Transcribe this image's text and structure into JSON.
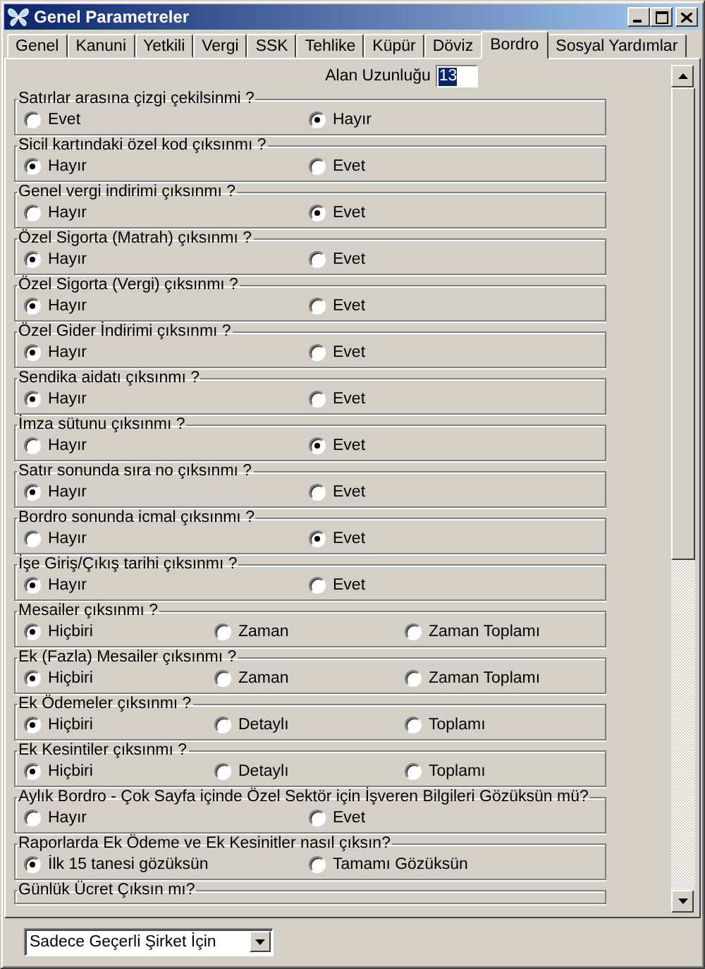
{
  "window": {
    "title": "Genel Parametreler"
  },
  "tabs": [
    {
      "label": "Genel",
      "selected": false
    },
    {
      "label": "Kanuni",
      "selected": false
    },
    {
      "label": "Yetkili",
      "selected": false
    },
    {
      "label": "Vergi",
      "selected": false
    },
    {
      "label": "SSK",
      "selected": false
    },
    {
      "label": "Tehlike",
      "selected": false
    },
    {
      "label": "Küpür",
      "selected": false
    },
    {
      "label": "Döviz",
      "selected": false
    },
    {
      "label": "Bordro",
      "selected": true
    },
    {
      "label": "Sosyal Yardımlar",
      "selected": false
    }
  ],
  "field_length": {
    "label": "Alan Uzunluğu",
    "value": "13"
  },
  "groups": [
    {
      "title": "Satırlar arasına çizgi çekilsinmi ?",
      "options": [
        {
          "label": "Evet",
          "selected": false
        },
        {
          "label": "Hayır",
          "selected": true
        }
      ]
    },
    {
      "title": "Sicil kartındaki özel kod çıksınmı ?",
      "options": [
        {
          "label": "Hayır",
          "selected": true
        },
        {
          "label": "Evet",
          "selected": false
        }
      ]
    },
    {
      "title": "Genel vergi indirimi çıksınmı ?",
      "options": [
        {
          "label": "Hayır",
          "selected": false
        },
        {
          "label": "Evet",
          "selected": true
        }
      ]
    },
    {
      "title": "Özel Sigorta (Matrah) çıksınmı ?",
      "options": [
        {
          "label": "Hayır",
          "selected": true
        },
        {
          "label": "Evet",
          "selected": false
        }
      ]
    },
    {
      "title": "Özel Sigorta (Vergi) çıksınmı ?",
      "options": [
        {
          "label": "Hayır",
          "selected": true
        },
        {
          "label": "Evet",
          "selected": false
        }
      ]
    },
    {
      "title": "Özel Gider İndirimi çıksınmı ?",
      "options": [
        {
          "label": "Hayır",
          "selected": true
        },
        {
          "label": "Evet",
          "selected": false
        }
      ]
    },
    {
      "title": "Sendika aidatı çıksınmı ?",
      "options": [
        {
          "label": "Hayır",
          "selected": true
        },
        {
          "label": "Evet",
          "selected": false
        }
      ]
    },
    {
      "title": "İmza sütunu çıksınmı ?",
      "options": [
        {
          "label": "Hayır",
          "selected": false
        },
        {
          "label": "Evet",
          "selected": true
        }
      ]
    },
    {
      "title": "Satır sonunda sıra no çıksınmı ?",
      "options": [
        {
          "label": "Hayır",
          "selected": true
        },
        {
          "label": "Evet",
          "selected": false
        }
      ]
    },
    {
      "title": "Bordro sonunda icmal çıksınmı ?",
      "options": [
        {
          "label": "Hayır",
          "selected": false
        },
        {
          "label": "Evet",
          "selected": true
        }
      ]
    },
    {
      "title": "İşe Giriş/Çıkış tarihi çıksınmı ?",
      "options": [
        {
          "label": "Hayır",
          "selected": true
        },
        {
          "label": "Evet",
          "selected": false
        }
      ]
    },
    {
      "title": "Mesailer çıksınmı ?",
      "options": [
        {
          "label": "Hiçbiri",
          "selected": true
        },
        {
          "label": "Zaman",
          "selected": false
        },
        {
          "label": "Zaman Toplamı",
          "selected": false
        }
      ]
    },
    {
      "title": "Ek (Fazla) Mesailer çıksınmı ?",
      "options": [
        {
          "label": "Hiçbiri",
          "selected": true
        },
        {
          "label": "Zaman",
          "selected": false
        },
        {
          "label": "Zaman Toplamı",
          "selected": false
        }
      ]
    },
    {
      "title": "Ek Ödemeler çıksınmı ?",
      "options": [
        {
          "label": "Hiçbiri",
          "selected": true
        },
        {
          "label": "Detaylı",
          "selected": false
        },
        {
          "label": "Toplamı",
          "selected": false
        }
      ]
    },
    {
      "title": "Ek Kesintiler çıksınmı ?",
      "options": [
        {
          "label": "Hiçbiri",
          "selected": true
        },
        {
          "label": "Detaylı",
          "selected": false
        },
        {
          "label": "Toplamı",
          "selected": false
        }
      ]
    },
    {
      "title": "Aylık Bordro - Çok Sayfa içinde Özel Sektör için  İşveren Bilgileri Gözüksün mü?",
      "options": [
        {
          "label": "Hayır",
          "selected": false
        },
        {
          "label": "Evet",
          "selected": false
        }
      ]
    },
    {
      "title": "Raporlarda Ek Ödeme ve Ek Kesinitler nasıl çıksın?",
      "options": [
        {
          "label": "İlk 15  tanesi gözüksün",
          "selected": true
        },
        {
          "label": "Tamamı Gözüksün",
          "selected": false
        }
      ]
    },
    {
      "title": "Günlük Ücret Çıksın mı?"
    }
  ],
  "scope_dropdown": {
    "value": "Sadece Geçerli Şirket İçin"
  }
}
